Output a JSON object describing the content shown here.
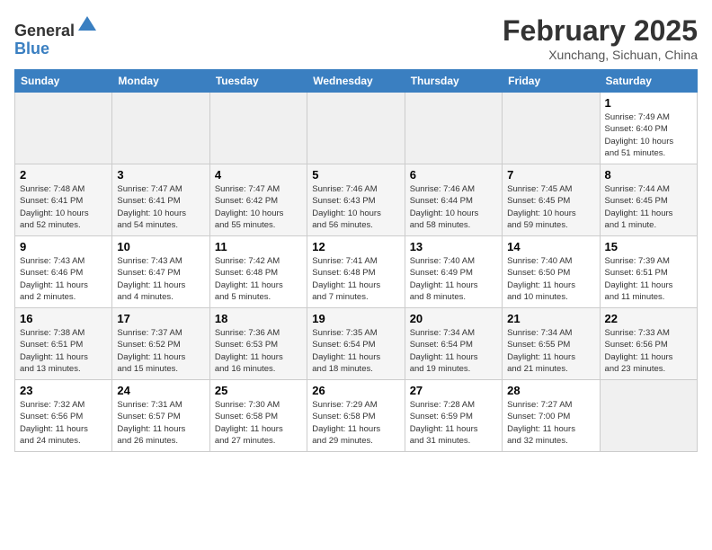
{
  "header": {
    "logo_line1": "General",
    "logo_line2": "Blue",
    "month": "February 2025",
    "location": "Xunchang, Sichuan, China"
  },
  "days_of_week": [
    "Sunday",
    "Monday",
    "Tuesday",
    "Wednesday",
    "Thursday",
    "Friday",
    "Saturday"
  ],
  "weeks": [
    [
      {
        "day": "",
        "info": ""
      },
      {
        "day": "",
        "info": ""
      },
      {
        "day": "",
        "info": ""
      },
      {
        "day": "",
        "info": ""
      },
      {
        "day": "",
        "info": ""
      },
      {
        "day": "",
        "info": ""
      },
      {
        "day": "1",
        "info": "Sunrise: 7:49 AM\nSunset: 6:40 PM\nDaylight: 10 hours\nand 51 minutes."
      }
    ],
    [
      {
        "day": "2",
        "info": "Sunrise: 7:48 AM\nSunset: 6:41 PM\nDaylight: 10 hours\nand 52 minutes."
      },
      {
        "day": "3",
        "info": "Sunrise: 7:47 AM\nSunset: 6:41 PM\nDaylight: 10 hours\nand 54 minutes."
      },
      {
        "day": "4",
        "info": "Sunrise: 7:47 AM\nSunset: 6:42 PM\nDaylight: 10 hours\nand 55 minutes."
      },
      {
        "day": "5",
        "info": "Sunrise: 7:46 AM\nSunset: 6:43 PM\nDaylight: 10 hours\nand 56 minutes."
      },
      {
        "day": "6",
        "info": "Sunrise: 7:46 AM\nSunset: 6:44 PM\nDaylight: 10 hours\nand 58 minutes."
      },
      {
        "day": "7",
        "info": "Sunrise: 7:45 AM\nSunset: 6:45 PM\nDaylight: 10 hours\nand 59 minutes."
      },
      {
        "day": "8",
        "info": "Sunrise: 7:44 AM\nSunset: 6:45 PM\nDaylight: 11 hours\nand 1 minute."
      }
    ],
    [
      {
        "day": "9",
        "info": "Sunrise: 7:43 AM\nSunset: 6:46 PM\nDaylight: 11 hours\nand 2 minutes."
      },
      {
        "day": "10",
        "info": "Sunrise: 7:43 AM\nSunset: 6:47 PM\nDaylight: 11 hours\nand 4 minutes."
      },
      {
        "day": "11",
        "info": "Sunrise: 7:42 AM\nSunset: 6:48 PM\nDaylight: 11 hours\nand 5 minutes."
      },
      {
        "day": "12",
        "info": "Sunrise: 7:41 AM\nSunset: 6:48 PM\nDaylight: 11 hours\nand 7 minutes."
      },
      {
        "day": "13",
        "info": "Sunrise: 7:40 AM\nSunset: 6:49 PM\nDaylight: 11 hours\nand 8 minutes."
      },
      {
        "day": "14",
        "info": "Sunrise: 7:40 AM\nSunset: 6:50 PM\nDaylight: 11 hours\nand 10 minutes."
      },
      {
        "day": "15",
        "info": "Sunrise: 7:39 AM\nSunset: 6:51 PM\nDaylight: 11 hours\nand 11 minutes."
      }
    ],
    [
      {
        "day": "16",
        "info": "Sunrise: 7:38 AM\nSunset: 6:51 PM\nDaylight: 11 hours\nand 13 minutes."
      },
      {
        "day": "17",
        "info": "Sunrise: 7:37 AM\nSunset: 6:52 PM\nDaylight: 11 hours\nand 15 minutes."
      },
      {
        "day": "18",
        "info": "Sunrise: 7:36 AM\nSunset: 6:53 PM\nDaylight: 11 hours\nand 16 minutes."
      },
      {
        "day": "19",
        "info": "Sunrise: 7:35 AM\nSunset: 6:54 PM\nDaylight: 11 hours\nand 18 minutes."
      },
      {
        "day": "20",
        "info": "Sunrise: 7:34 AM\nSunset: 6:54 PM\nDaylight: 11 hours\nand 19 minutes."
      },
      {
        "day": "21",
        "info": "Sunrise: 7:34 AM\nSunset: 6:55 PM\nDaylight: 11 hours\nand 21 minutes."
      },
      {
        "day": "22",
        "info": "Sunrise: 7:33 AM\nSunset: 6:56 PM\nDaylight: 11 hours\nand 23 minutes."
      }
    ],
    [
      {
        "day": "23",
        "info": "Sunrise: 7:32 AM\nSunset: 6:56 PM\nDaylight: 11 hours\nand 24 minutes."
      },
      {
        "day": "24",
        "info": "Sunrise: 7:31 AM\nSunset: 6:57 PM\nDaylight: 11 hours\nand 26 minutes."
      },
      {
        "day": "25",
        "info": "Sunrise: 7:30 AM\nSunset: 6:58 PM\nDaylight: 11 hours\nand 27 minutes."
      },
      {
        "day": "26",
        "info": "Sunrise: 7:29 AM\nSunset: 6:58 PM\nDaylight: 11 hours\nand 29 minutes."
      },
      {
        "day": "27",
        "info": "Sunrise: 7:28 AM\nSunset: 6:59 PM\nDaylight: 11 hours\nand 31 minutes."
      },
      {
        "day": "28",
        "info": "Sunrise: 7:27 AM\nSunset: 7:00 PM\nDaylight: 11 hours\nand 32 minutes."
      },
      {
        "day": "",
        "info": ""
      }
    ]
  ]
}
